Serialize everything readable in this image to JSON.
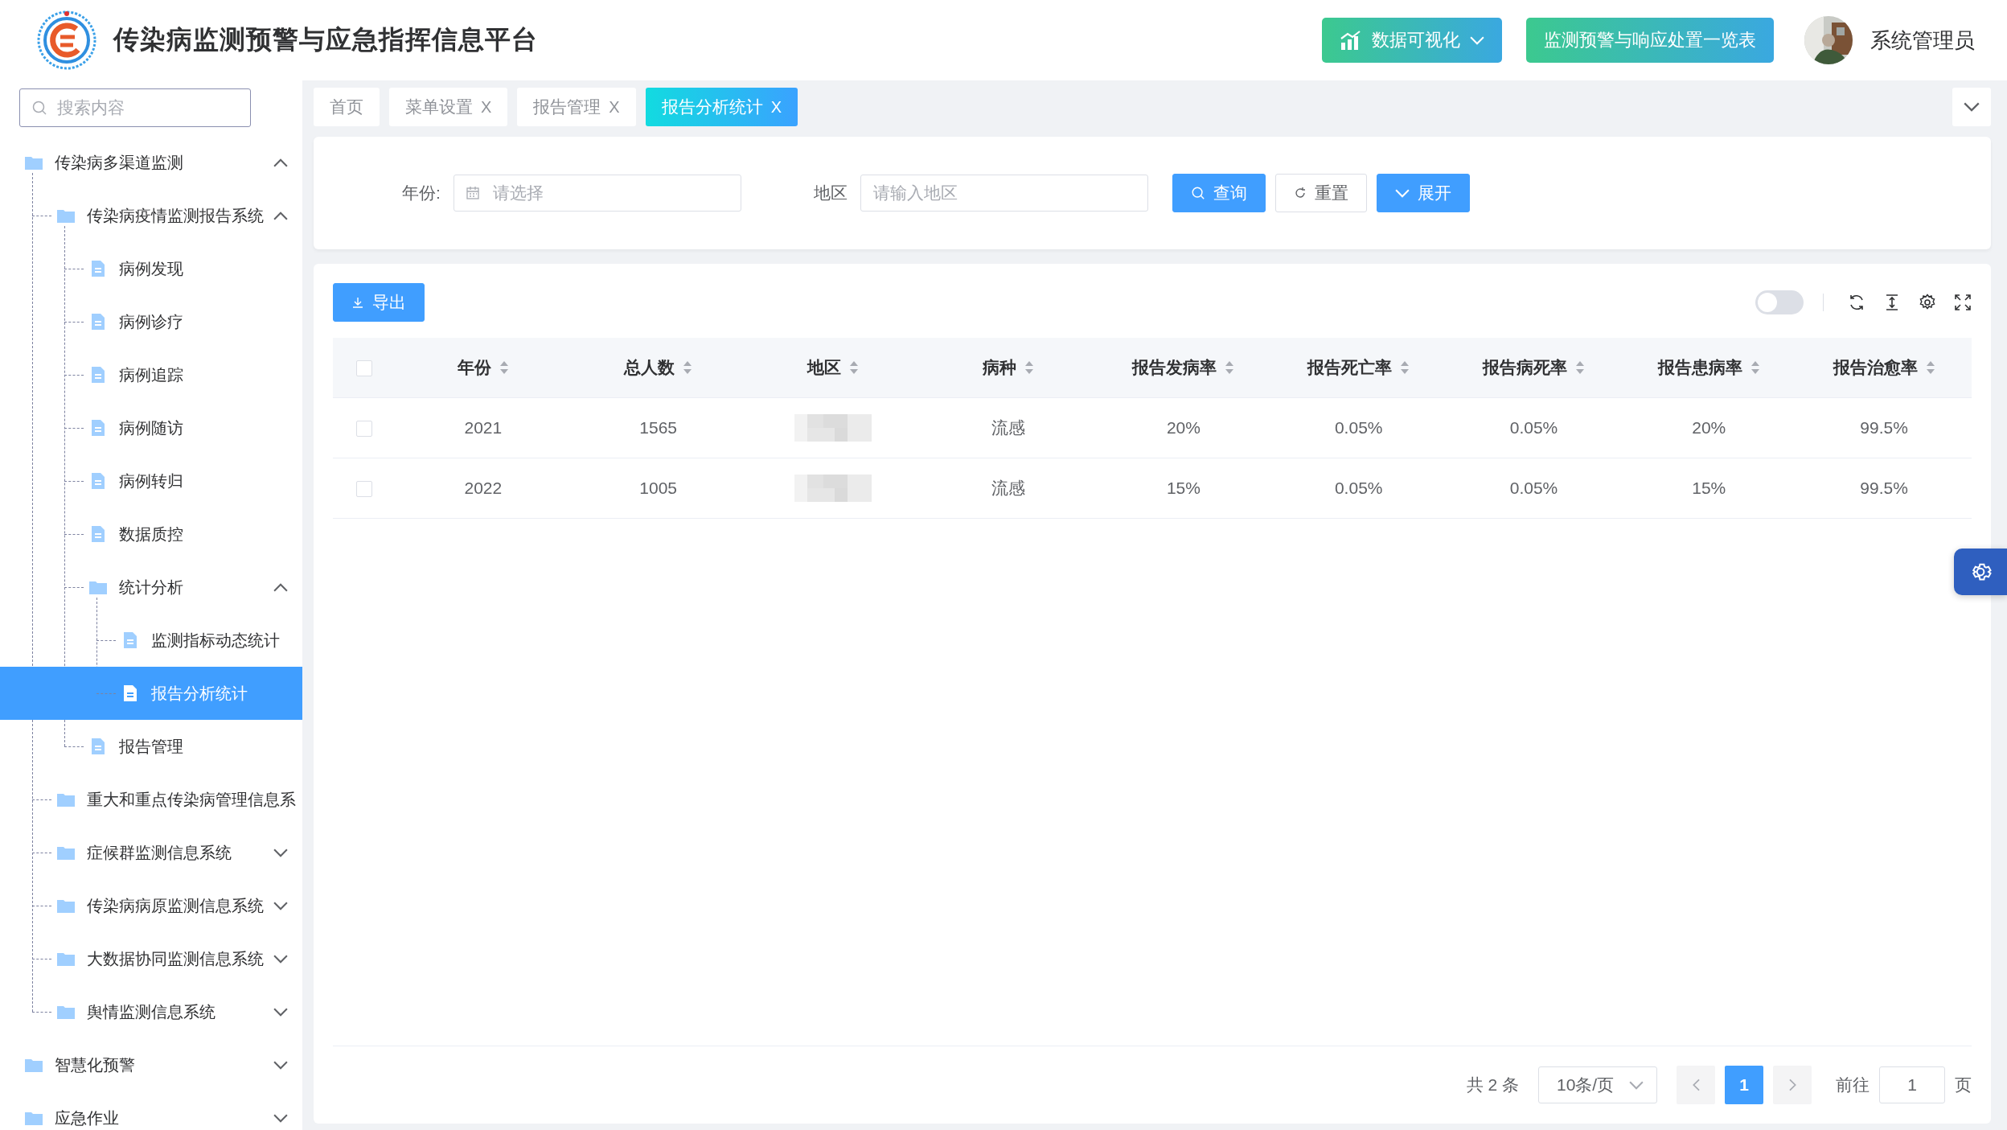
{
  "header": {
    "title": "传染病监测预警与应急指挥信息平台",
    "buttons": [
      {
        "label": "数据可视化",
        "kind": "chart-dropdown"
      },
      {
        "label": "监测预警与响应处置一览表",
        "kind": "plain"
      }
    ],
    "user": {
      "name": "系统管理员"
    }
  },
  "sidebar": {
    "search": {
      "placeholder": "搜索内容"
    },
    "tree": [
      {
        "label": "传染病多渠道监测",
        "kind": "folder",
        "expanded": true,
        "selected": false,
        "children": [
          {
            "label": "传染病疫情监测报告系统",
            "kind": "folder",
            "expanded": true,
            "selected": false,
            "children": [
              {
                "label": "病例发现",
                "kind": "file",
                "selected": false
              },
              {
                "label": "病例诊疗",
                "kind": "file",
                "selected": false
              },
              {
                "label": "病例追踪",
                "kind": "file",
                "selected": false
              },
              {
                "label": "病例随访",
                "kind": "file",
                "selected": false
              },
              {
                "label": "病例转归",
                "kind": "file",
                "selected": false
              },
              {
                "label": "数据质控",
                "kind": "file",
                "selected": false
              },
              {
                "label": "统计分析",
                "kind": "folder",
                "expanded": true,
                "selected": false,
                "children": [
                  {
                    "label": "监测指标动态统计",
                    "kind": "file",
                    "selected": false
                  },
                  {
                    "label": "报告分析统计",
                    "kind": "file",
                    "selected": true
                  }
                ]
              },
              {
                "label": "报告管理",
                "kind": "file",
                "selected": false
              }
            ]
          },
          {
            "label": "重大和重点传染病管理信息系",
            "kind": "folder",
            "selected": false
          },
          {
            "label": "症候群监测信息系统",
            "kind": "folder",
            "expanded": false,
            "selected": false
          },
          {
            "label": "传染病病原监测信息系统",
            "kind": "folder",
            "expanded": false,
            "selected": false
          },
          {
            "label": "大数据协同监测信息系统",
            "kind": "folder",
            "expanded": false,
            "selected": false
          },
          {
            "label": "舆情监测信息系统",
            "kind": "folder",
            "expanded": false,
            "selected": false
          }
        ]
      },
      {
        "label": "智慧化预警",
        "kind": "folder",
        "expanded": false,
        "selected": false
      },
      {
        "label": "应急作业",
        "kind": "folder",
        "expanded": false,
        "selected": false
      }
    ]
  },
  "tabs": [
    {
      "label": "首页",
      "selected": false
    },
    {
      "label": "菜单设置",
      "close": "X",
      "selected": false
    },
    {
      "label": "报告管理",
      "close": "X",
      "selected": false
    },
    {
      "label": "报告分析统计",
      "close": "X",
      "selected": true
    }
  ],
  "filters": [
    {
      "label": "年份:",
      "placeholder": "请选择",
      "kind": "date"
    },
    {
      "label": "地区",
      "placeholder": "请输入地区",
      "kind": "text"
    }
  ],
  "filter_buttons": [
    {
      "label": "查询",
      "kind": "search"
    },
    {
      "label": "重置",
      "kind": "reset"
    },
    {
      "label": "展开",
      "kind": "expand"
    }
  ],
  "toolbar": {
    "export": "导出",
    "switch_on": false
  },
  "table": {
    "select_all_checked": false,
    "columns": [
      "年份",
      "总人数",
      "地区",
      "病种",
      "报告发病率",
      "报告死亡率",
      "报告病死率",
      "报告患病率",
      "报告治愈率"
    ],
    "rows": [
      {
        "checked": false,
        "cells": [
          "2021",
          "1565",
          {
            "kind": "redacted"
          },
          "流感",
          "20%",
          "0.05%",
          "0.05%",
          "20%",
          "99.5%"
        ]
      },
      {
        "checked": false,
        "cells": [
          "2022",
          "1005",
          {
            "kind": "redacted"
          },
          "流感",
          "15%",
          "0.05%",
          "0.05%",
          "15%",
          "99.5%"
        ]
      }
    ]
  },
  "pagination": {
    "total": "共 2 条",
    "page_size": "10条/页",
    "pages": [
      {
        "label": "1",
        "selected": true
      }
    ],
    "goto_label": "前往",
    "goto_value": "1",
    "page_suffix": "页"
  }
}
